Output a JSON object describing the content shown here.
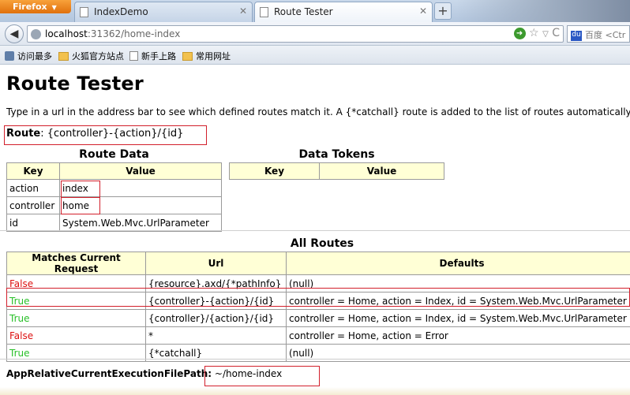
{
  "browser": {
    "app_button": "Firefox",
    "tabs": [
      {
        "label": "IndexDemo"
      },
      {
        "label": "Route Tester"
      }
    ],
    "new_tab": "+",
    "url_host": "localhost",
    "url_rest": ":31362/home-index",
    "search_placeholder": "百度 <Ctr",
    "bookmarks": [
      "访问最多",
      "火狐官方站点",
      "新手上路",
      "常用网址"
    ]
  },
  "page": {
    "title": "Route Tester",
    "intro": "Type in a url in the address bar to see which defined routes match it. A {*catchall} route is added to the list of routes automatically in cas",
    "route_label": "Route",
    "route_value": "{controller}-{action}/{id}",
    "route_data": {
      "caption": "Route Data",
      "headers": [
        "Key",
        "Value"
      ],
      "rows": [
        [
          "action",
          "index"
        ],
        [
          "controller",
          "home"
        ],
        [
          "id",
          "System.Web.Mvc.UrlParameter"
        ]
      ]
    },
    "data_tokens": {
      "caption": "Data Tokens",
      "headers": [
        "Key",
        "Value"
      ]
    },
    "all_routes": {
      "caption": "All Routes",
      "headers": [
        "Matches Current Request",
        "Url",
        "Defaults"
      ],
      "rows": [
        [
          "False",
          "{resource}.axd/{*pathInfo}",
          "(null)"
        ],
        [
          "True",
          "{controller}-{action}/{id}",
          "controller = Home, action = Index, id = System.Web.Mvc.UrlParameter"
        ],
        [
          "True",
          "{controller}/{action}/{id}",
          "controller = Home, action = Index, id = System.Web.Mvc.UrlParameter"
        ],
        [
          "False",
          "*",
          "controller = Home, action = Error"
        ],
        [
          "True",
          "{*catchall}",
          "(null)"
        ]
      ]
    },
    "footer_label": "AppRelativeCurrentExecutionFilePath",
    "footer_value": "~/home-index"
  }
}
